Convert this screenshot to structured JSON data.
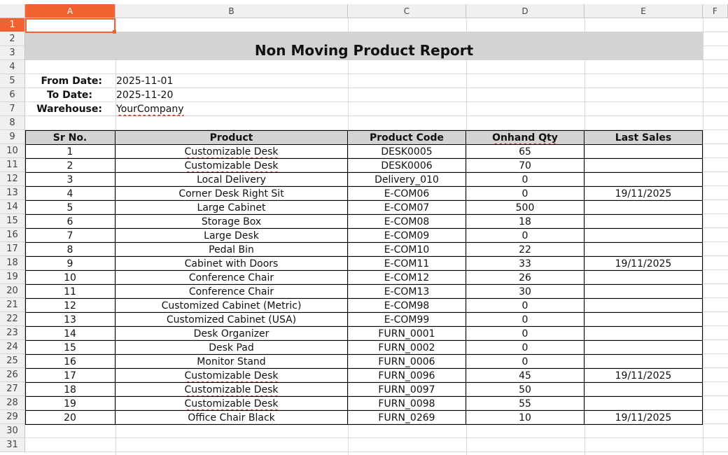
{
  "sheet": {
    "columns": [
      "A",
      "B",
      "C",
      "D",
      "E",
      "F"
    ],
    "active_column": "A",
    "rows": [
      "1",
      "2",
      "3",
      "4",
      "5",
      "6",
      "7",
      "8",
      "9",
      "10",
      "11",
      "12",
      "13",
      "14",
      "15",
      "16",
      "17",
      "18",
      "19",
      "20",
      "21",
      "22",
      "23",
      "24",
      "25",
      "26",
      "27",
      "28",
      "29",
      "30",
      "31"
    ],
    "active_row": "1"
  },
  "report": {
    "title": "Non Moving Product Report",
    "from_label": "From Date:",
    "from_value": "2025-11-01",
    "to_label": "To Date:",
    "to_value": "2025-11-20",
    "warehouse_label": "Warehouse:",
    "warehouse_value": "YourCompany"
  },
  "table": {
    "headers": [
      "Sr No.",
      "Product",
      "Product Code",
      "Onhand Qty",
      "Last Sales"
    ],
    "rows": [
      [
        "1",
        "Customizable Desk",
        "DESK0005",
        "65",
        ""
      ],
      [
        "2",
        "Customizable Desk",
        "DESK0006",
        "70",
        ""
      ],
      [
        "3",
        "Local Delivery",
        "Delivery_010",
        "0",
        ""
      ],
      [
        "4",
        "Corner Desk Right Sit",
        "E-COM06",
        "0",
        "19/11/2025"
      ],
      [
        "5",
        "Large Cabinet",
        "E-COM07",
        "500",
        ""
      ],
      [
        "6",
        "Storage Box",
        "E-COM08",
        "18",
        ""
      ],
      [
        "7",
        "Large Desk",
        "E-COM09",
        "0",
        ""
      ],
      [
        "8",
        "Pedal Bin",
        "E-COM10",
        "22",
        ""
      ],
      [
        "9",
        "Cabinet with Doors",
        "E-COM11",
        "33",
        "19/11/2025"
      ],
      [
        "10",
        "Conference Chair",
        "E-COM12",
        "26",
        ""
      ],
      [
        "11",
        "Conference Chair",
        "E-COM13",
        "30",
        ""
      ],
      [
        "12",
        "Customized Cabinet (Metric)",
        "E-COM98",
        "0",
        ""
      ],
      [
        "13",
        "Customized Cabinet (USA)",
        "E-COM99",
        "0",
        ""
      ],
      [
        "14",
        "Desk Organizer",
        "FURN_0001",
        "0",
        ""
      ],
      [
        "15",
        "Desk Pad",
        "FURN_0002",
        "0",
        ""
      ],
      [
        "16",
        "Monitor Stand",
        "FURN_0006",
        "0",
        ""
      ],
      [
        "17",
        "Customizable Desk",
        "FURN_0096",
        "45",
        "19/11/2025"
      ],
      [
        "18",
        "Customizable Desk",
        "FURN_0097",
        "50",
        ""
      ],
      [
        "19",
        "Customizable Desk",
        "FURN_0098",
        "55",
        ""
      ],
      [
        "20",
        "Office Chair Black",
        "FURN_0269",
        "10",
        "19/11/2025"
      ]
    ]
  }
}
